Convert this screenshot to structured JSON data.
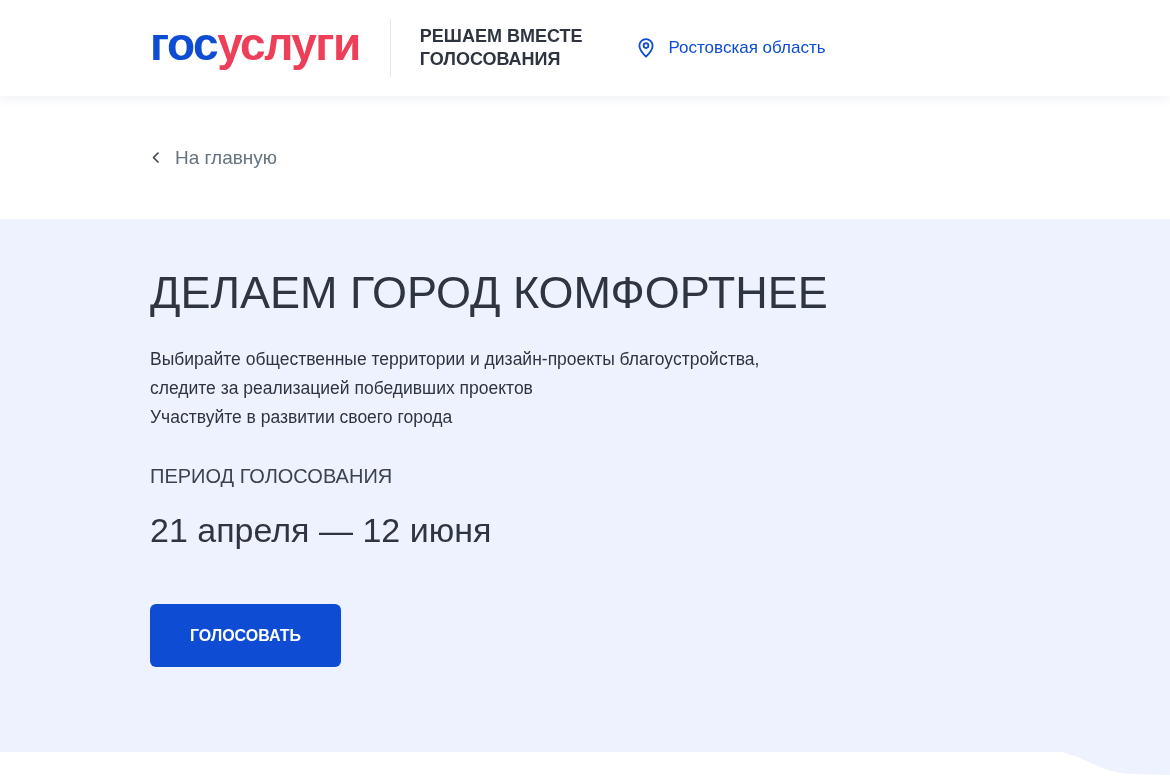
{
  "header": {
    "logo": {
      "parts": [
        "гос",
        "услуги"
      ]
    },
    "section_title": {
      "lines": [
        "РЕШАЕМ ВМЕСТЕ",
        "ГОЛОСОВАНИЯ"
      ]
    },
    "region": "Ростовская область"
  },
  "back_link": "На главную",
  "hero": {
    "title": "ДЕЛАЕМ ГОРОД КОМФОРТНЕЕ",
    "description": {
      "lines": [
        "Выбирайте общественные территории и дизайн-проекты благоустройства,",
        "следите за реализацией победивших проектов",
        "Участвуйте в развитии своего города"
      ]
    },
    "period_label": "ПЕРИОД ГОЛОСОВАНИЯ",
    "period": "21 апреля — 12 июня",
    "button": "ГОЛОСОВАТЬ"
  }
}
